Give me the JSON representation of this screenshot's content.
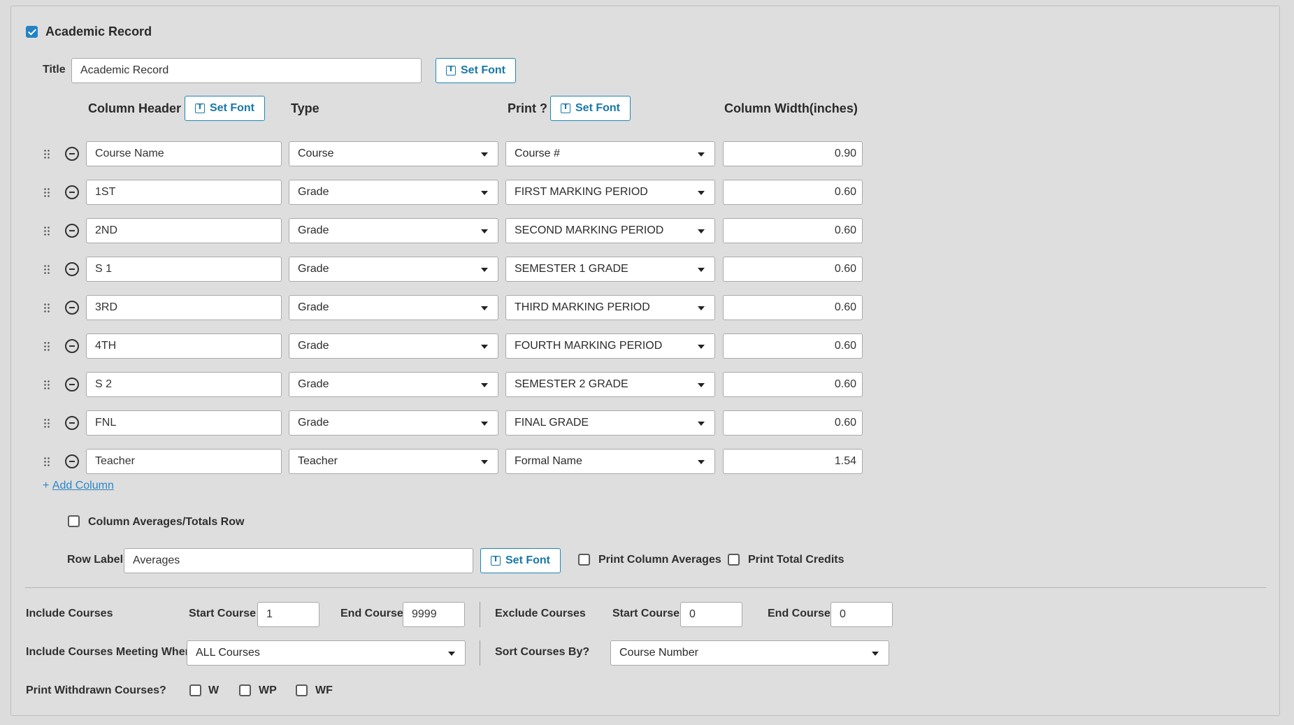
{
  "section": {
    "enabled_checked": true,
    "label": "Academic Record"
  },
  "title_row": {
    "label": "Title",
    "value": "Academic Record",
    "set_font": "Set Font"
  },
  "columns_header": {
    "column_header": "Column Header",
    "set_font": "Set Font",
    "type": "Type",
    "print": "Print ?",
    "print_set_font": "Set Font",
    "width": "Column Width(inches)"
  },
  "rows": [
    {
      "header": "Course Name",
      "type": "Course",
      "print": "Course #",
      "width": "0.90"
    },
    {
      "header": "1ST",
      "type": "Grade",
      "print": "FIRST MARKING PERIOD",
      "width": "0.60"
    },
    {
      "header": "2ND",
      "type": "Grade",
      "print": "SECOND MARKING PERIOD",
      "width": "0.60"
    },
    {
      "header": "S 1",
      "type": "Grade",
      "print": "SEMESTER 1 GRADE",
      "width": "0.60"
    },
    {
      "header": "3RD",
      "type": "Grade",
      "print": "THIRD MARKING PERIOD",
      "width": "0.60"
    },
    {
      "header": "4TH",
      "type": "Grade",
      "print": "FOURTH MARKING PERIOD",
      "width": "0.60"
    },
    {
      "header": "S 2",
      "type": "Grade",
      "print": "SEMESTER 2 GRADE",
      "width": "0.60"
    },
    {
      "header": "FNL",
      "type": "Grade",
      "print": "FINAL GRADE",
      "width": "0.60"
    },
    {
      "header": "Teacher",
      "type": "Teacher",
      "print": "Formal Name",
      "width": "1.54"
    }
  ],
  "add_column": {
    "plus": "+",
    "label": "Add Column"
  },
  "averages": {
    "totals_row_label": "Column Averages/Totals Row",
    "totals_row_checked": false,
    "row_label": "Row Label",
    "row_value": "Averages",
    "set_font": "Set Font",
    "print_column_averages": "Print Column Averages",
    "print_total_credits": "Print Total Credits"
  },
  "include": {
    "label": "Include Courses",
    "start_label": "Start Course",
    "start_value": "1",
    "end_label": "End Course",
    "end_value": "9999"
  },
  "exclude": {
    "label": "Exclude Courses",
    "start_label": "Start Course",
    "start_value": "0",
    "end_label": "End Course",
    "end_value": "0"
  },
  "meeting": {
    "label": "Include Courses Meeting When?",
    "value": "ALL Courses"
  },
  "sort": {
    "label": "Sort Courses By?",
    "value": "Course Number"
  },
  "withdrawn": {
    "label": "Print Withdrawn Courses?",
    "options": [
      "W",
      "WP",
      "WF"
    ]
  }
}
